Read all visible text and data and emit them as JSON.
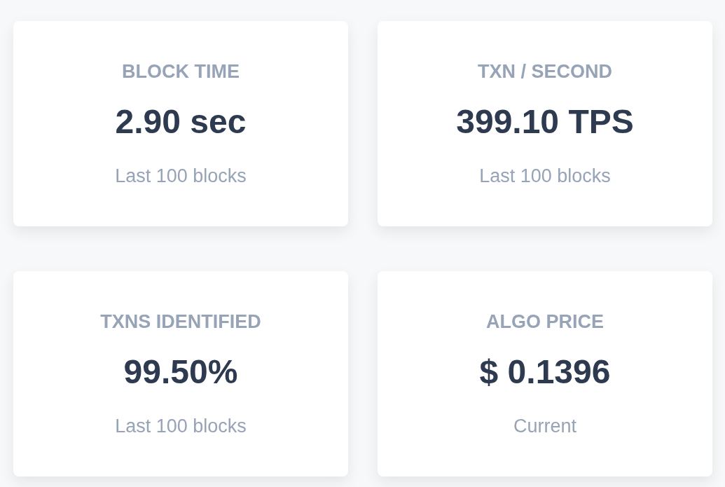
{
  "stats": [
    {
      "title": "BLOCK TIME",
      "value": "2.90 sec",
      "caption": "Last 100 blocks"
    },
    {
      "title": "TXN / SECOND",
      "value": "399.10 TPS",
      "caption": "Last 100 blocks"
    },
    {
      "title": "TXNS IDENTIFIED",
      "value": "99.50%",
      "caption": "Last 100 blocks"
    },
    {
      "title": "ALGO PRICE",
      "value": "$ 0.1396",
      "caption": "Current"
    }
  ]
}
